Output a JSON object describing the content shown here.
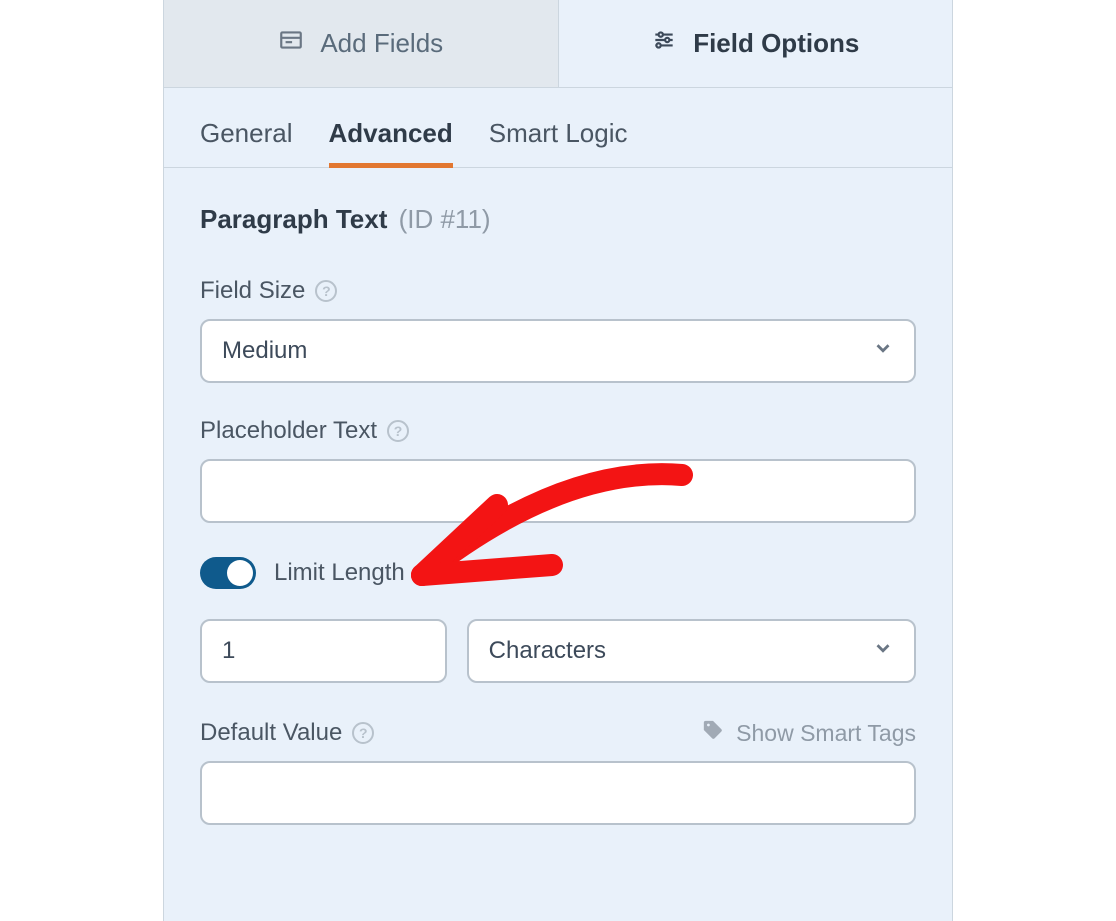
{
  "topTabs": {
    "addFields": "Add Fields",
    "fieldOptions": "Field Options"
  },
  "subTabs": {
    "general": "General",
    "advanced": "Advanced",
    "smartLogic": "Smart Logic"
  },
  "fieldTitle": {
    "name": "Paragraph Text",
    "id": "(ID #11)"
  },
  "labels": {
    "fieldSize": "Field Size",
    "placeholderText": "Placeholder Text",
    "limitLength": "Limit Length",
    "defaultValue": "Default Value",
    "showSmartTags": "Show Smart Tags"
  },
  "values": {
    "fieldSize": "Medium",
    "placeholderText": "",
    "limitLengthEnabled": true,
    "limitNumber": "1",
    "limitUnit": "Characters",
    "defaultValue": ""
  }
}
